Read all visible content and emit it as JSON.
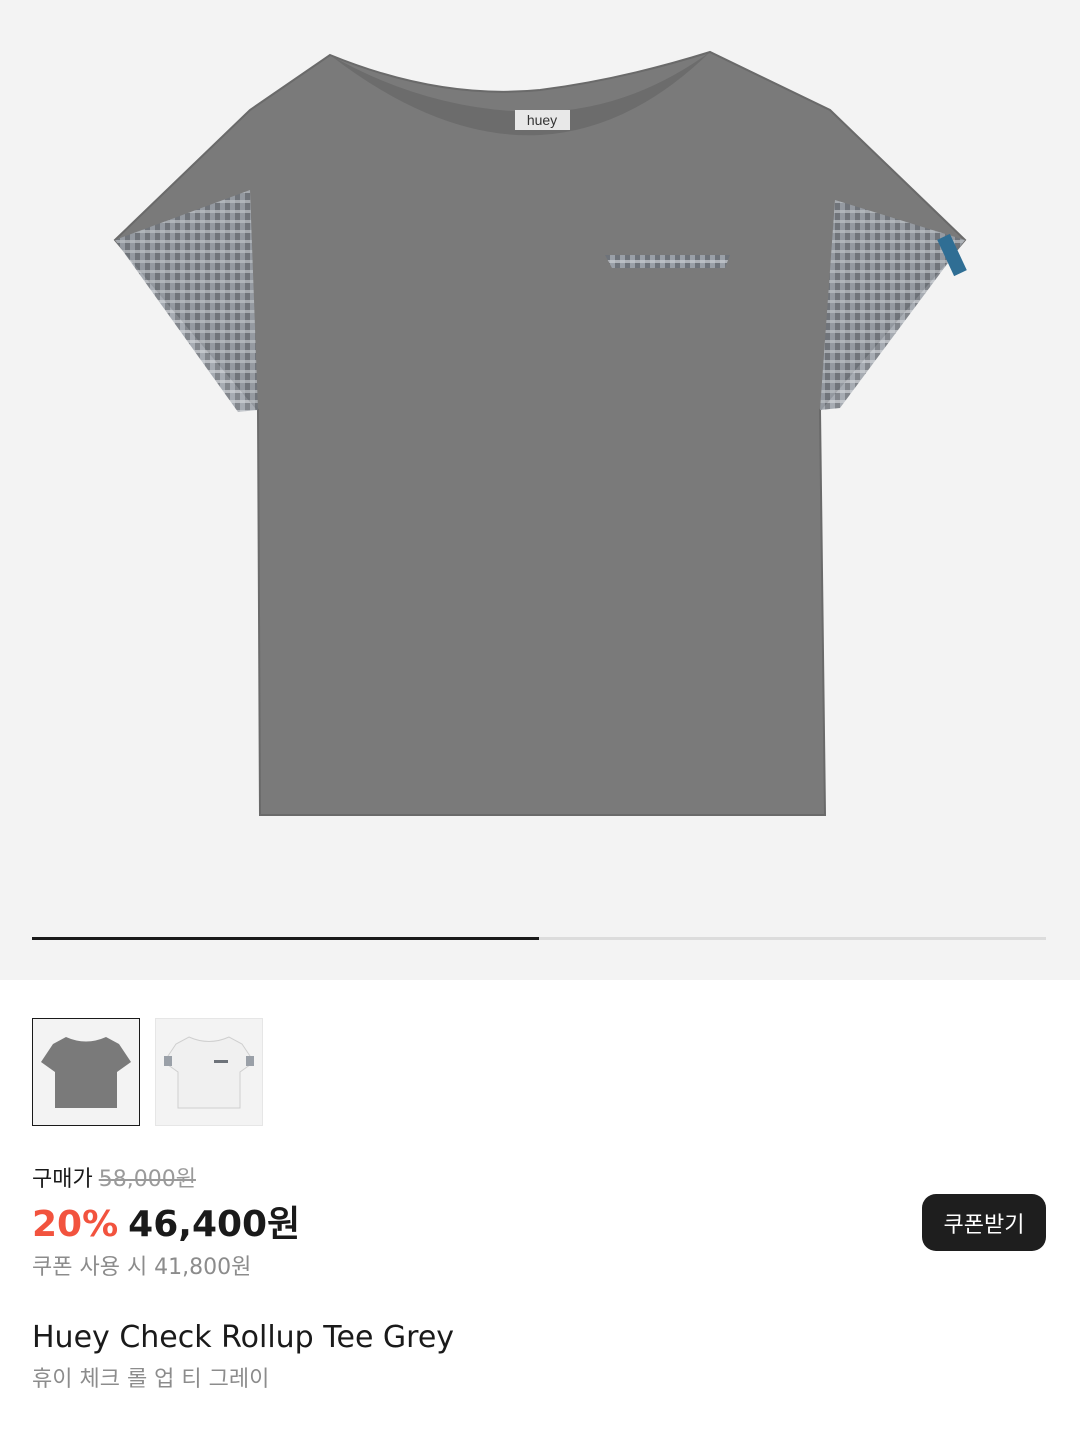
{
  "gallery": {
    "progress_percent": 50,
    "shirt_brand_tag": "huey"
  },
  "thumbnails": [
    {
      "name": "grey tee",
      "active": true
    },
    {
      "name": "white tee",
      "active": false
    }
  ],
  "price": {
    "label": "구매가",
    "original_price": "58,000원",
    "discount_percent": "20%",
    "sale_price": "46,400원",
    "coupon_price_text": "쿠폰 사용 시 41,800원"
  },
  "coupon_button": {
    "label": "쿠폰받기"
  },
  "product": {
    "name_en": "Huey Check Rollup Tee Grey",
    "name_ko": "휴이 체크 롤 업 티 그레이"
  },
  "colors": {
    "discount": "#f2533e",
    "button_bg": "#1e1e1e",
    "shirt_grey": "#7a7a7a",
    "shirt_white": "#f0f0f0"
  }
}
